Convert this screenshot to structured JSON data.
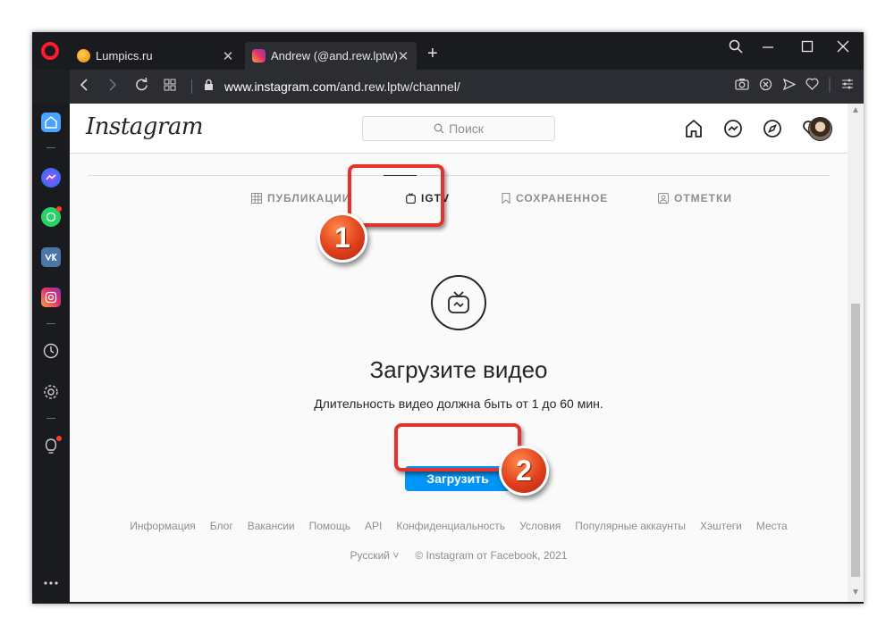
{
  "browser": {
    "tabs": [
      {
        "title": "Lumpics.ru",
        "close": "✕"
      },
      {
        "title": "Andrew (@and.rew.lptw) • ",
        "close": "✕"
      }
    ],
    "new_tab": "+",
    "url_host": "www.instagram.com",
    "url_path": "/and.rew.lptw/channel/"
  },
  "instagram": {
    "logo": "Instagram",
    "search_placeholder": "Поиск",
    "profile_tabs": [
      {
        "label": "ПУБЛИКАЦИИ",
        "icon": "grid-icon"
      },
      {
        "label": "IGTV",
        "icon": "igtv-icon"
      },
      {
        "label": "СОХРАНЕННОЕ",
        "icon": "bookmark-icon"
      },
      {
        "label": "ОТМЕТКИ",
        "icon": "tagged-icon"
      }
    ],
    "empty_state": {
      "title": "Загрузите видео",
      "subtitle": "Длительность видео должна быть от 1 до 60 мин.",
      "button": "Загрузить"
    },
    "footer_links": [
      "Информация",
      "Блог",
      "Вакансии",
      "Помощь",
      "API",
      "Конфиденциальность",
      "Условия",
      "Популярные аккаунты",
      "Хэштеги",
      "Места"
    ],
    "language": "Русский ˅",
    "copyright": "© Instagram от Facebook, 2021"
  },
  "annotations": {
    "step1": "1",
    "step2": "2"
  },
  "colors": {
    "accent_blue": "#0095f6",
    "annotation_red": "#e5322d",
    "opera_red": "#ff1b2d"
  }
}
